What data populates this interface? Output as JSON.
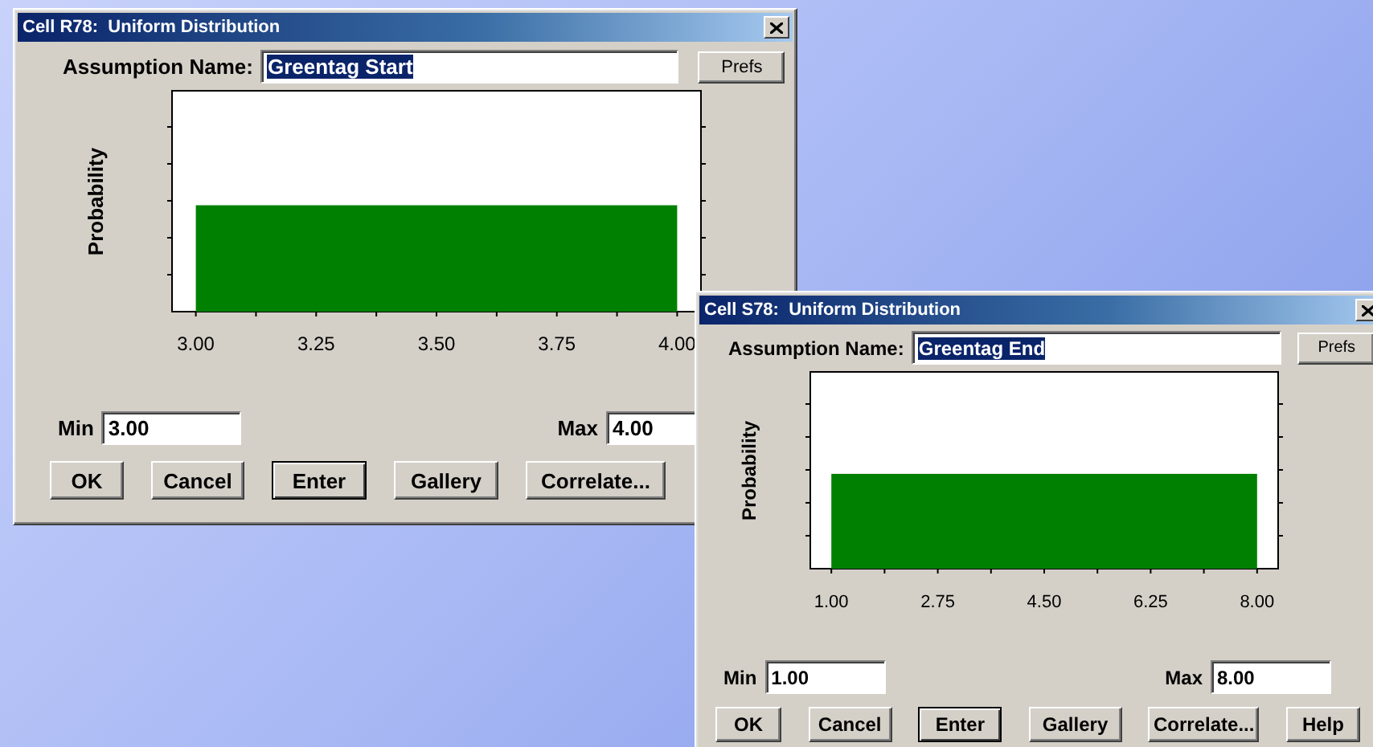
{
  "windows": [
    {
      "title": "Cell R78:  Uniform Distribution",
      "name_label": "Assumption Name:",
      "name_value": "Greentag Start",
      "name_selected": true,
      "prefs": "Prefs",
      "chart": {
        "ylabel": "Probability",
        "tick_labels": [
          "3.00",
          "3.25",
          "3.50",
          "3.75",
          "4.00"
        ]
      },
      "min_label": "Min",
      "min_value": "3.00",
      "max_label": "Max",
      "max_value": "4.00",
      "buttons": [
        {
          "label": "OK",
          "default": false
        },
        {
          "label": "Cancel",
          "default": false
        },
        {
          "label": "Enter",
          "default": true
        },
        {
          "label": "Gallery",
          "default": false
        },
        {
          "label": "Correlate...",
          "default": false
        }
      ]
    },
    {
      "title": "Cell S78:  Uniform Distribution",
      "name_label": "Assumption Name:",
      "name_value": "Greentag End",
      "name_selected": true,
      "prefs": "Prefs",
      "chart": {
        "ylabel": "Probability",
        "tick_labels": [
          "1.00",
          "2.75",
          "4.50",
          "6.25",
          "8.00"
        ]
      },
      "min_label": "Min",
      "min_value": "1.00",
      "max_label": "Max",
      "max_value": "8.00",
      "buttons": [
        {
          "label": "OK",
          "default": false
        },
        {
          "label": "Cancel",
          "default": false
        },
        {
          "label": "Enter",
          "default": true
        },
        {
          "label": "Gallery",
          "default": false
        },
        {
          "label": "Correlate...",
          "default": false
        },
        {
          "label": "Help",
          "default": false
        }
      ]
    }
  ]
}
